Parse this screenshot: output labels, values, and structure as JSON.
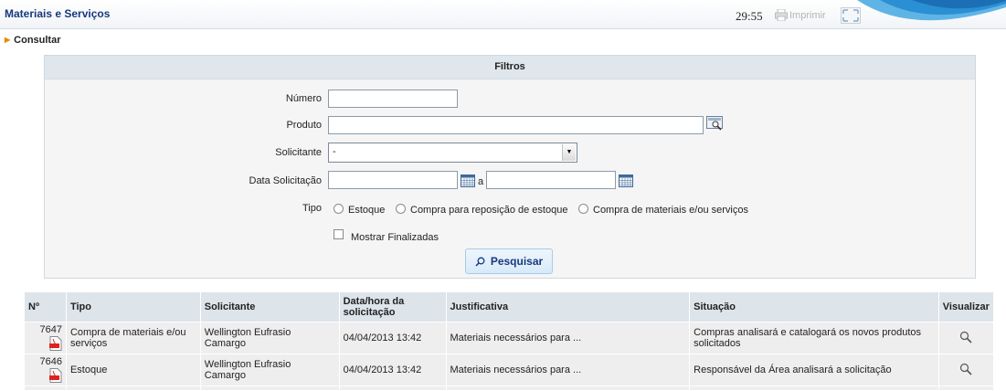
{
  "header": {
    "title": "Materiais e Serviços",
    "clock": "29:55",
    "print_label": "Imprimir"
  },
  "nav": {
    "consultar": "Consultar"
  },
  "filters": {
    "title": "Filtros",
    "numero_label": "Número",
    "numero_value": "",
    "produto_label": "Produto",
    "produto_value": "",
    "solicitante_label": "Solicitante",
    "solicitante_value": "-",
    "data_label": "Data Solicitação",
    "data_from": "",
    "data_to": "",
    "data_sep": "a",
    "tipo_label": "Tipo",
    "tipo_options": [
      "Estoque",
      "Compra para reposição de estoque",
      "Compra de materiais e/ou serviços"
    ],
    "finalizadas_label": "Mostrar Finalizadas",
    "search_button": "Pesquisar"
  },
  "table": {
    "headers": [
      "Nº",
      "Tipo",
      "Solicitante",
      "Data/hora da solicitação",
      "Justificativa",
      "Situação",
      "Visualizar"
    ],
    "rows": [
      {
        "numero": "7647",
        "tipo": "Compra de materiais e/ou serviços",
        "solicitante": "Wellington Eufrasio Camargo",
        "data": "04/04/2013 13:42",
        "justificativa": "Materiais necessários para ...",
        "situacao": "Compras analisará e catalogará os novos produtos solicitados"
      },
      {
        "numero": "7646",
        "tipo": "Estoque",
        "solicitante": "Wellington Eufrasio Camargo",
        "data": "04/04/2013 13:42",
        "justificativa": "Materiais necessários para ...",
        "situacao": "Responsável da Área analisará a solicitação"
      }
    ]
  },
  "colors": {
    "title_blue": "#17387c",
    "header_bg": "#dfe6ec",
    "row_bg": "#eeeeee",
    "accent_orange": "#e68a00"
  }
}
